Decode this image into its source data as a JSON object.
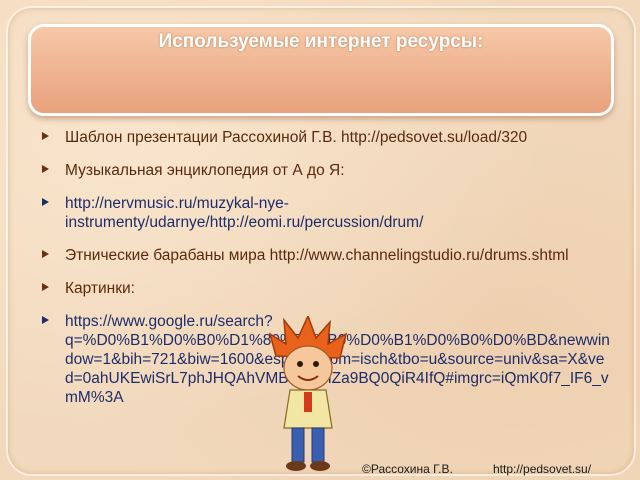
{
  "title": "Используемые интернет ресурсы:",
  "items": [
    {
      "text": "Шаблон презентации Рассохиной Г.В. http://pedsovet.su/load/320",
      "kind": "text"
    },
    {
      "text": "Музыкальная энциклопедия от А до Я:",
      "kind": "text"
    },
    {
      "text": "http://nervmusic.ru/muzykal-nye-instrumenty/udarnye/http://eomi.ru/percussion/drum/",
      "kind": "link"
    },
    {
      "text": "Этнические барабаны мира http://www.channelingstudio.ru/drums.shtml",
      "kind": "text"
    },
    {
      "text": "Картинки:",
      "kind": "text"
    },
    {
      "text": "https://www.google.ru/search?q=%D0%B1%D0%B0%D1%80%D0%B0%D0%B1%D0%B0%D0%BD&newwindow=1&bih=721&biw=1600&espv=2&tbm=isch&tbo=u&source=univ&sa=X&ved=0ahUKEwiSrL7phJHQAhVMBSwKHZa9BQ0QiR4IfQ#imgrc=iQmK0f7_IF6_vmM%3A",
      "kind": "link"
    }
  ],
  "footer": {
    "author": "©Рассохина Г.В.",
    "url": "http://pedsovet.su/"
  },
  "colors": {
    "title_box": "#f0b694",
    "text_brown": "#5b2a0e",
    "link_blue": "#1e2c6a"
  },
  "icons": {
    "character": "cartoon-boy-icon"
  }
}
